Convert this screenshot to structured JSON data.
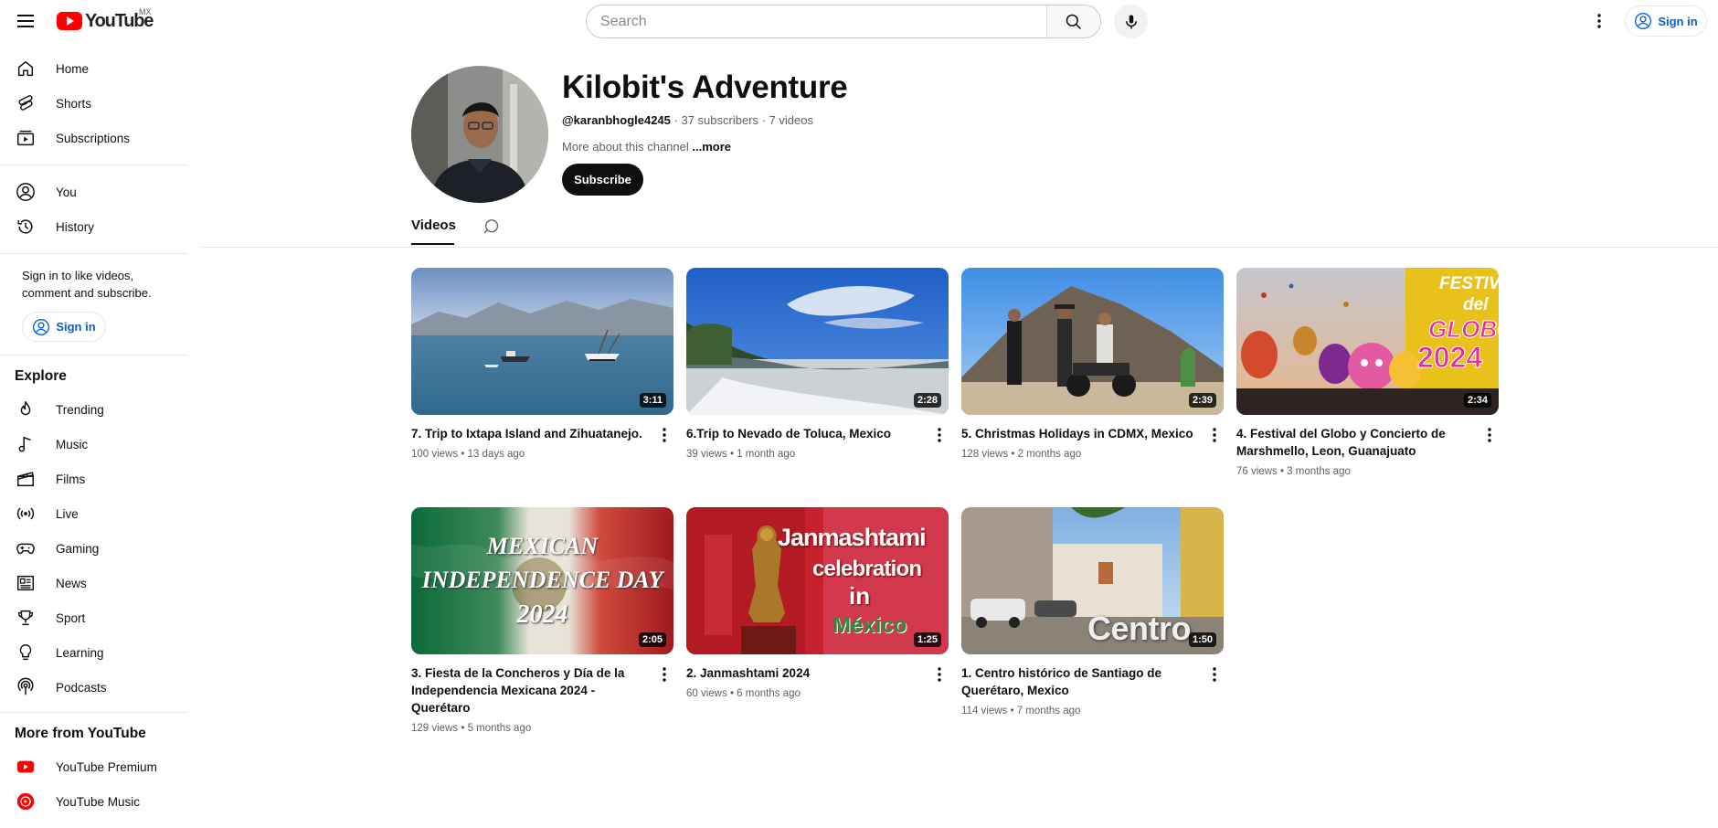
{
  "topbar": {
    "logo_text": "YouTube",
    "region": "MX",
    "search_placeholder": "Search",
    "signin_label": "Sign in"
  },
  "sidebar": {
    "primary": [
      {
        "label": "Home",
        "icon": "home-icon"
      },
      {
        "label": "Shorts",
        "icon": "shorts-icon"
      },
      {
        "label": "Subscriptions",
        "icon": "subscriptions-icon"
      }
    ],
    "you": [
      {
        "label": "You",
        "icon": "you-icon"
      },
      {
        "label": "History",
        "icon": "history-icon"
      }
    ],
    "signin_prompt": "Sign in to like videos, comment and subscribe.",
    "signin_label": "Sign in",
    "explore_heading": "Explore",
    "explore": [
      {
        "label": "Trending",
        "icon": "trending-icon"
      },
      {
        "label": "Music",
        "icon": "music-icon"
      },
      {
        "label": "Films",
        "icon": "films-icon"
      },
      {
        "label": "Live",
        "icon": "live-icon"
      },
      {
        "label": "Gaming",
        "icon": "gaming-icon"
      },
      {
        "label": "News",
        "icon": "news-icon"
      },
      {
        "label": "Sport",
        "icon": "sport-icon"
      },
      {
        "label": "Learning",
        "icon": "learning-icon"
      },
      {
        "label": "Podcasts",
        "icon": "podcasts-icon"
      }
    ],
    "more_heading": "More from YouTube",
    "more": [
      {
        "label": "YouTube Premium",
        "icon": "youtube-premium-icon"
      },
      {
        "label": "YouTube Music",
        "icon": "youtube-music-icon"
      }
    ]
  },
  "channel": {
    "name": "Kilobit's Adventure",
    "handle": "@karanbhogle4245",
    "subscribers": "37 subscribers",
    "videos_count": "7 videos",
    "separator": " · ",
    "about": "More about this channel",
    "about_more": "...more",
    "subscribe_label": "Subscribe"
  },
  "tabs": {
    "videos_label": "Videos"
  },
  "videos": [
    {
      "title": "7. Trip to Ixtapa Island and Zihuatanejo.",
      "views": "100 views",
      "age": "13 days ago",
      "duration": "3:11"
    },
    {
      "title": "6.Trip to Nevado de Toluca, Mexico",
      "views": "39 views",
      "age": "1 month ago",
      "duration": "2:28"
    },
    {
      "title": "5. Christmas Holidays in CDMX, Mexico",
      "views": "128 views",
      "age": "2 months ago",
      "duration": "2:39"
    },
    {
      "title": "4. Festival del Globo y Concierto de Marshmello, Leon, Guanajuato",
      "views": "76 views",
      "age": "3 months ago",
      "duration": "2:34"
    },
    {
      "title": "3. Fiesta de la Concheros y Día de la Independencia Mexicana 2024 - Querétaro",
      "views": "129 views",
      "age": "5 months ago",
      "duration": "2:05"
    },
    {
      "title": "2. Janmashtami 2024",
      "views": "60 views",
      "age": "6 months ago",
      "duration": "1:25"
    },
    {
      "title": "1. Centro histórico de Santiago de Querétaro, Mexico",
      "views": "114 views",
      "age": "7 months ago",
      "duration": "1:50"
    }
  ],
  "thumb_text": {
    "festival_1": "FESTIVAL",
    "festival_2": "del",
    "festival_3": "GLOBO",
    "festival_4": "2024",
    "indep_1": "MEXICAN",
    "indep_2": "INDEPENDENCE DAY",
    "indep_3": "2024",
    "janm_1": "Janmashtami",
    "janm_2": "celebration",
    "janm_3": "in",
    "janm_4": "México",
    "centro": "Centro"
  },
  "meta_dot": " • "
}
